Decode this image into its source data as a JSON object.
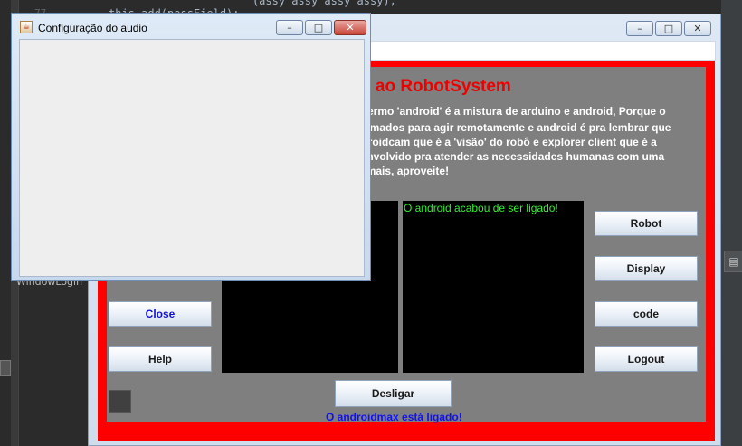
{
  "ide": {
    "code_line_1": "                      (assy assy assy assy),",
    "code_line_2_kw": "this",
    "code_line_2_rest": ".add(passField);",
    "line_number": "77",
    "tree_item": "WindowLogin",
    "right_panel_icon": "document-icon"
  },
  "main_window": {
    "controls": {
      "minimize": "–",
      "maximize": "□",
      "close": "✕"
    },
    "welcome_title": "o ao RobotSystem",
    "description_lines": [
      "x, o termo 'android' é a mistura de arduino e android, Porque o",
      "rogramados para agir remotamente e android é pra lembrar que",
      "o o droidcam que é a 'visão' do robô e explorer client que é a",
      "desenvolvido pra atender as necessidades humanas com uma",
      "cia amais, aproveite!"
    ],
    "status_message": "O android acabou de ser ligado!",
    "buttons": {
      "robot": "Robot",
      "display": "Display",
      "code": "code",
      "logout": "Logout",
      "close": "Close",
      "help": "Help",
      "desligar": "Desligar"
    },
    "bottom_status": "O androidmax está ligado!"
  },
  "audio_window": {
    "title": "Configuração do audio",
    "controls": {
      "minimize": "–",
      "maximize": "□",
      "close": "✕"
    }
  }
}
